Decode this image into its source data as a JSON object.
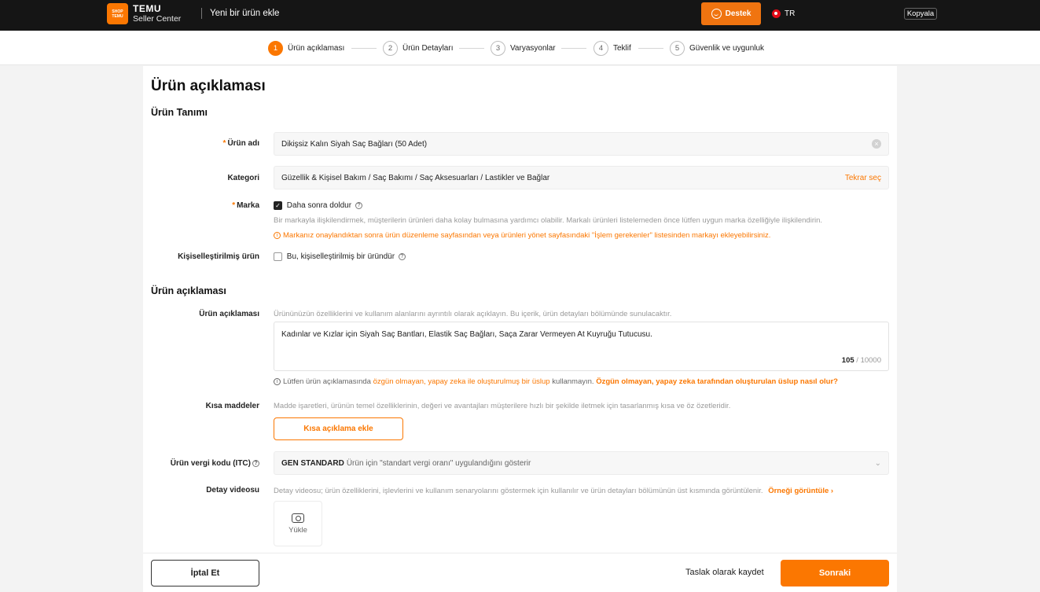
{
  "topbar": {
    "logo_line1": "SHOP",
    "logo_line2": "TEMU",
    "brand_name": "TEMU",
    "brand_sub": "Seller Center",
    "page_heading": "Yeni bir ürün ekle",
    "support_label": "Destek",
    "language": "TR",
    "copy_label": "Kopyala"
  },
  "steps": [
    {
      "num": "1",
      "label": "Ürün açıklaması",
      "active": true
    },
    {
      "num": "2",
      "label": "Ürün Detayları",
      "active": false
    },
    {
      "num": "3",
      "label": "Varyasyonlar",
      "active": false
    },
    {
      "num": "4",
      "label": "Teklif",
      "active": false
    },
    {
      "num": "5",
      "label": "Güvenlik ve uygunluk",
      "active": false
    }
  ],
  "page": {
    "title": "Ürün açıklaması",
    "section_definition": "Ürün Tanımı",
    "section_description": "Ürün açıklaması"
  },
  "form": {
    "product_name": {
      "label": "Ürün adı",
      "value": "Dikişsiz Kalın Siyah Saç Bağları (50 Adet)"
    },
    "category": {
      "label": "Kategori",
      "value": "Güzellik & Kişisel Bakım / Saç Bakımı / Saç Aksesuarları / Lastikler ve Bağlar",
      "reselect": "Tekrar seç"
    },
    "brand": {
      "label": "Marka",
      "checkbox_label": "Daha sonra doldur",
      "checked": true,
      "hint": "Bir markayla ilişkilendirmek, müşterilerin ürünleri daha kolay bulmasına yardımcı olabilir. Markalı ürünleri listelemeden önce lütfen uygun marka özelliğiyle ilişkilendirin.",
      "warning": "Markanız onaylandıktan sonra ürün düzenleme sayfasından veya ürünleri yönet sayfasındaki \"İşlem gerekenler\" listesinden markayı ekleyebilirsiniz."
    },
    "personalized": {
      "label": "Kişiselleştirilmiş ürün",
      "checkbox_label": "Bu, kişiselleştirilmiş bir üründür",
      "checked": false
    },
    "description": {
      "label": "Ürün açıklaması",
      "hint": "Ürününüzün özelliklerini ve kullanım alanlarını ayrıntılı olarak açıklayın. Bu içerik, ürün detayları bölümünde sunulacaktır.",
      "value": "Kadınlar ve Kızlar için Siyah Saç Bantları, Elastik Saç Bağları, Saça Zarar Vermeyen At Kuyruğu Tutucusu.",
      "count": "105",
      "max": "/ 10000",
      "note_prefix": "Lütfen ürün açıklamasında",
      "note_orange": "özgün olmayan, yapay zeka ile oluşturulmuş bir üslup",
      "note_middle": "kullanmayın.",
      "note_link": "Özgün olmayan, yapay zeka tarafından oluşturulan üslup nasıl olur?"
    },
    "bullets": {
      "label": "Kısa maddeler",
      "hint": "Madde işaretleri, ürünün temel özelliklerinin, değeri ve avantajları müşterilere hızlı bir şekilde iletmek için tasarlanmış kısa ve öz özetleridir.",
      "add_button": "Kısa açıklama ekle"
    },
    "tax_code": {
      "label": "Ürün vergi kodu (ITC)",
      "value_bold": "GEN STANDARD",
      "value_rest": "Ürün için \"standart vergi oranı\" uygulandığını gösterir"
    },
    "video": {
      "label": "Detay videosu",
      "hint": "Detay videosu; ürün özelliklerini, işlevlerini ve kullanım senaryolarını göstermek için kullanılır ve ürün detayları bölümünün üst kısmında görüntülenir.",
      "example_link": "Örneği görüntüle",
      "upload_label": "Yükle"
    }
  },
  "footer": {
    "cancel": "İptal Et",
    "draft": "Taslak olarak kaydet",
    "next": "Sonraki"
  },
  "colors": {
    "accent": "#fb7701",
    "topbar": "#151515"
  }
}
